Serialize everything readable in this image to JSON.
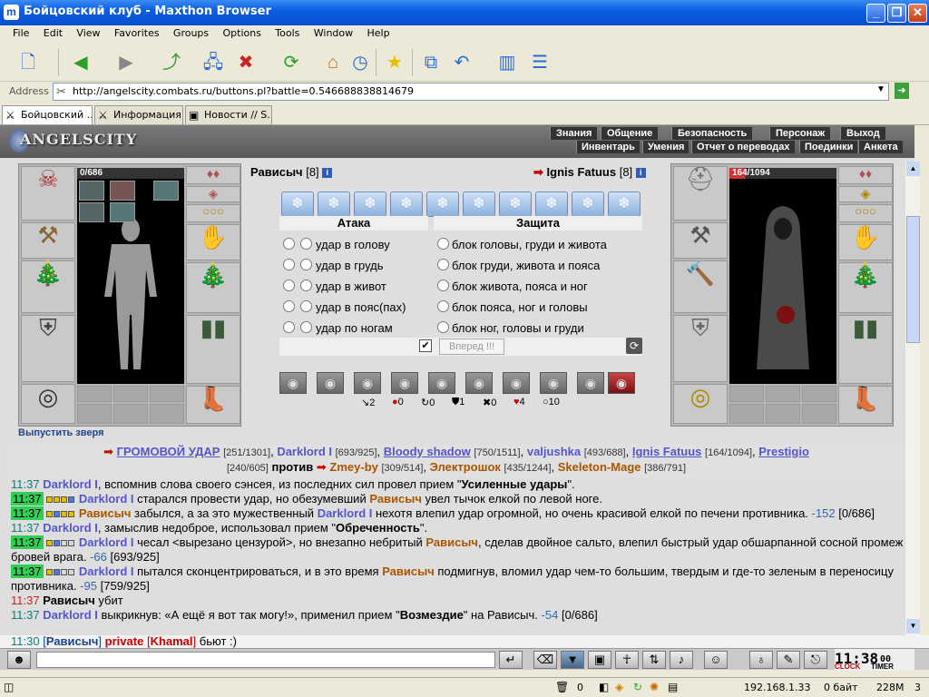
{
  "window": {
    "title": "Бойцовский клуб - Maxthon Browser"
  },
  "menu": [
    "File",
    "Edit",
    "View",
    "Favorites",
    "Groups",
    "Options",
    "Tools",
    "Window",
    "Help"
  ],
  "address": {
    "label": "Address",
    "url": "http://angelscity.combats.ru/buttons.pl?battle=0.546688838814679"
  },
  "tabs": [
    "Бойцовский ...",
    "Информация...",
    "Новости // S..."
  ],
  "game": {
    "logo": "ANGELSCITY",
    "nav_top": [
      "Знания",
      "Общение",
      "Безопасность",
      "Персонаж",
      "Выход"
    ],
    "nav_bottom": [
      "Инвентарь",
      "Умения",
      "Отчет о переводах",
      "Поединки",
      "Анкета"
    ],
    "left_player": {
      "name": "Рависыч",
      "level": "[8]",
      "hp": "0/686",
      "release_beast": "Выпустить зверя"
    },
    "right_player": {
      "name": "Ignis Fatuus",
      "level": "[8]",
      "hp": "164/1094"
    },
    "attack_header": "Атака",
    "defense_header": "Защита",
    "attacks": [
      "удар в голову",
      "удар в грудь",
      "удар в живот",
      "удар в пояс(пах)",
      "удар по ногам"
    ],
    "defenses": [
      "блок головы, груди и живота",
      "блок груди, живота и пояса",
      "блок живота, пояса и ног",
      "блок пояса, ног и головы",
      "блок ног, головы и груди"
    ],
    "forward_button": "Вперед !!!",
    "stats": [
      "2",
      "0",
      "0",
      "1",
      "0",
      "4",
      "10"
    ],
    "team1": [
      {
        "name": "ГРОМОВОЙ УДАР",
        "hp": "[251/1301]"
      },
      {
        "name": "Darklord I",
        "hp": "[693/925]"
      },
      {
        "name": "Bloody shadow",
        "hp": "[750/1511]"
      },
      {
        "name": "valjushka",
        "hp": "[493/688]"
      },
      {
        "name": "Ignis Fatuus",
        "hp": "[164/1094]"
      },
      {
        "name": "Prestigio",
        "hp": "[240/605]"
      }
    ],
    "vs": "против",
    "team2": [
      {
        "name": "Zmey-by",
        "hp": "[309/514]"
      },
      {
        "name": "Электрошок",
        "hp": "[435/1244]"
      },
      {
        "name": "Skeleton-Mage",
        "hp": "[386/791]"
      }
    ],
    "log": [
      {
        "t": "11:37",
        "s": "Darklord I",
        "m": ", вспомнив слова своего сэнсея, из последних сил провел прием \"",
        "b": "Усиленные удары",
        "e": "\"."
      },
      {
        "t": "11:37",
        "s": "Darklord I",
        "m": " старался провести удар, но обезумевший ",
        "o": "Рависыч",
        "e": " увел тычок елкой по левой ноге."
      },
      {
        "t": "11:37",
        "s": "Рависыч",
        "m": " забылся, а за это мужественный ",
        "o": "Darklord I",
        "e": " нехотя влепил удар огромной, но очень красивой елкой по печени противника.",
        "d": "-152",
        "h": "[0/686]"
      },
      {
        "t": "11:37",
        "s": "Darklord I",
        "m": ", замыслив недоброе, использовал прием \"",
        "b": "Обреченность",
        "e": "\"."
      },
      {
        "t": "11:37",
        "s": "Darklord I",
        "m": " чесал <вырезано цензурой>, но внезапно небритый ",
        "o": "Рависыч",
        "e": ", сделав двойное сальто, влепил быстрый удар обшарпанной сосной промеж бровей врага.",
        "d": "-66",
        "h": "[693/925]"
      },
      {
        "t": "11:37",
        "s": "Darklord I",
        "m": " пытался сконцентрироваться, и в это время ",
        "o": "Рависыч",
        "e": " подмигнув, вломил удар чем-то большим, твердым и где-то зеленым в переносицу противника.",
        "d": "-95",
        "h": "[759/925]"
      },
      {
        "t": "11:37",
        "s": "Рависыч",
        "m": " убит",
        "e": ""
      },
      {
        "t": "11:37",
        "s": "Darklord I",
        "m": " выкрикнув: «А ещё я вот так могу!», применил прием \"",
        "b": "Возмездие",
        "e": "\" на Рависыч.",
        "d": "-54",
        "h": "[0/686]"
      }
    ],
    "chat": {
      "time": "11:30",
      "nick": "Рависыч",
      "private": "private",
      "target": "Khamal",
      "msg": "бьют :)"
    },
    "clock": "11:38",
    "clock_sec": "00",
    "clock_labels": [
      "CLOCK",
      "TIMER"
    ]
  },
  "status": {
    "num": "0",
    "ip": "192.168.1.33",
    "bytes": "0 байт",
    "mem": "228M",
    "count": "3"
  }
}
